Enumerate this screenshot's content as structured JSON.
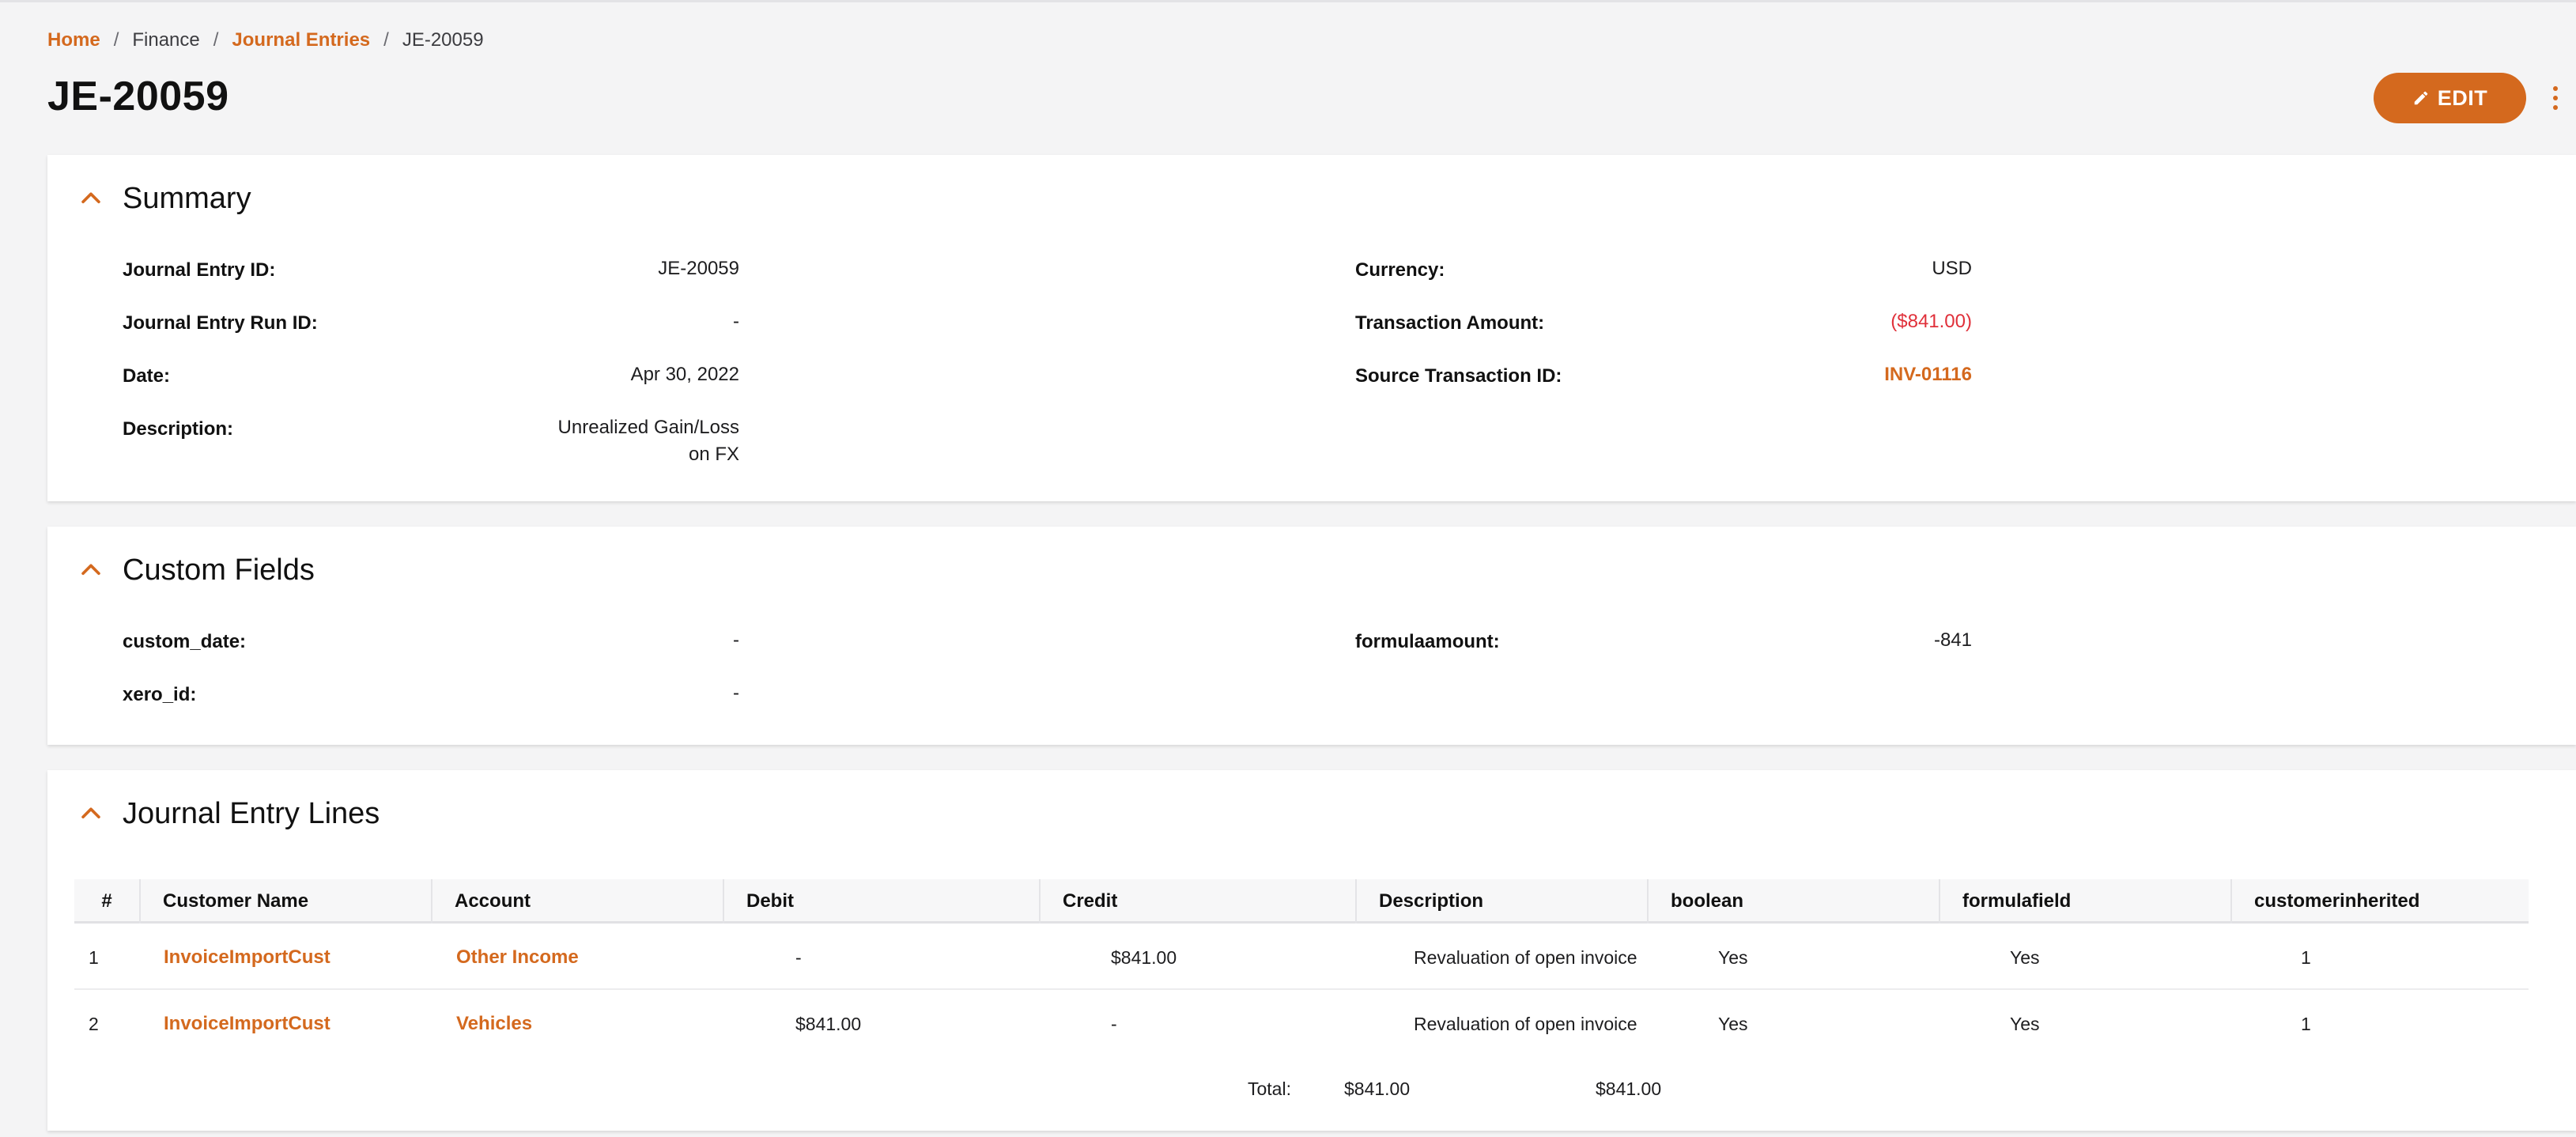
{
  "breadcrumb": {
    "home": "Home",
    "finance": "Finance",
    "journal_entries": "Journal Entries",
    "current": "JE-20059",
    "separator": "/"
  },
  "page": {
    "title": "JE-20059",
    "edit_label": "EDIT",
    "accent_color": "#d4691e",
    "negative_color": "#e0303a"
  },
  "summary": {
    "title": "Summary",
    "journal_entry_id_label": "Journal Entry ID:",
    "journal_entry_id_value": "JE-20059",
    "run_id_label": "Journal Entry Run ID:",
    "run_id_value": "-",
    "date_label": "Date:",
    "date_value": "Apr 30, 2022",
    "description_label": "Description:",
    "description_value_line1": "Unrealized Gain/Loss",
    "description_value_line2": "on FX",
    "currency_label": "Currency:",
    "currency_value": "USD",
    "transaction_amount_label": "Transaction Amount:",
    "transaction_amount_value": "($841.00)",
    "source_txn_label": "Source Transaction ID:",
    "source_txn_value": "INV-01116"
  },
  "custom_fields": {
    "title": "Custom Fields",
    "custom_date_label": "custom_date:",
    "custom_date_value": "-",
    "xero_id_label": "xero_id:",
    "xero_id_value": "-",
    "formulaamount_label": "formulaamount:",
    "formulaamount_value": "-841"
  },
  "lines": {
    "title": "Journal Entry Lines",
    "columns": [
      "#",
      "Customer Name",
      "Account",
      "Debit",
      "Credit",
      "Description",
      "boolean",
      "formulafield",
      "customerinherited"
    ],
    "rows": [
      {
        "num": "1",
        "customer": "InvoiceImportCust",
        "account": "Other Income",
        "debit": "-",
        "credit": "$841.00",
        "description": "Revaluation of open invoice",
        "boolean": "Yes",
        "formulafield": "Yes",
        "inherited": "1"
      },
      {
        "num": "2",
        "customer": "InvoiceImportCust",
        "account": "Vehicles",
        "debit": "$841.00",
        "credit": "-",
        "description": "Revaluation of open invoice",
        "boolean": "Yes",
        "formulafield": "Yes",
        "inherited": "1"
      }
    ],
    "total_label": "Total:",
    "total_debit": "$841.00",
    "total_credit": "$841.00"
  }
}
